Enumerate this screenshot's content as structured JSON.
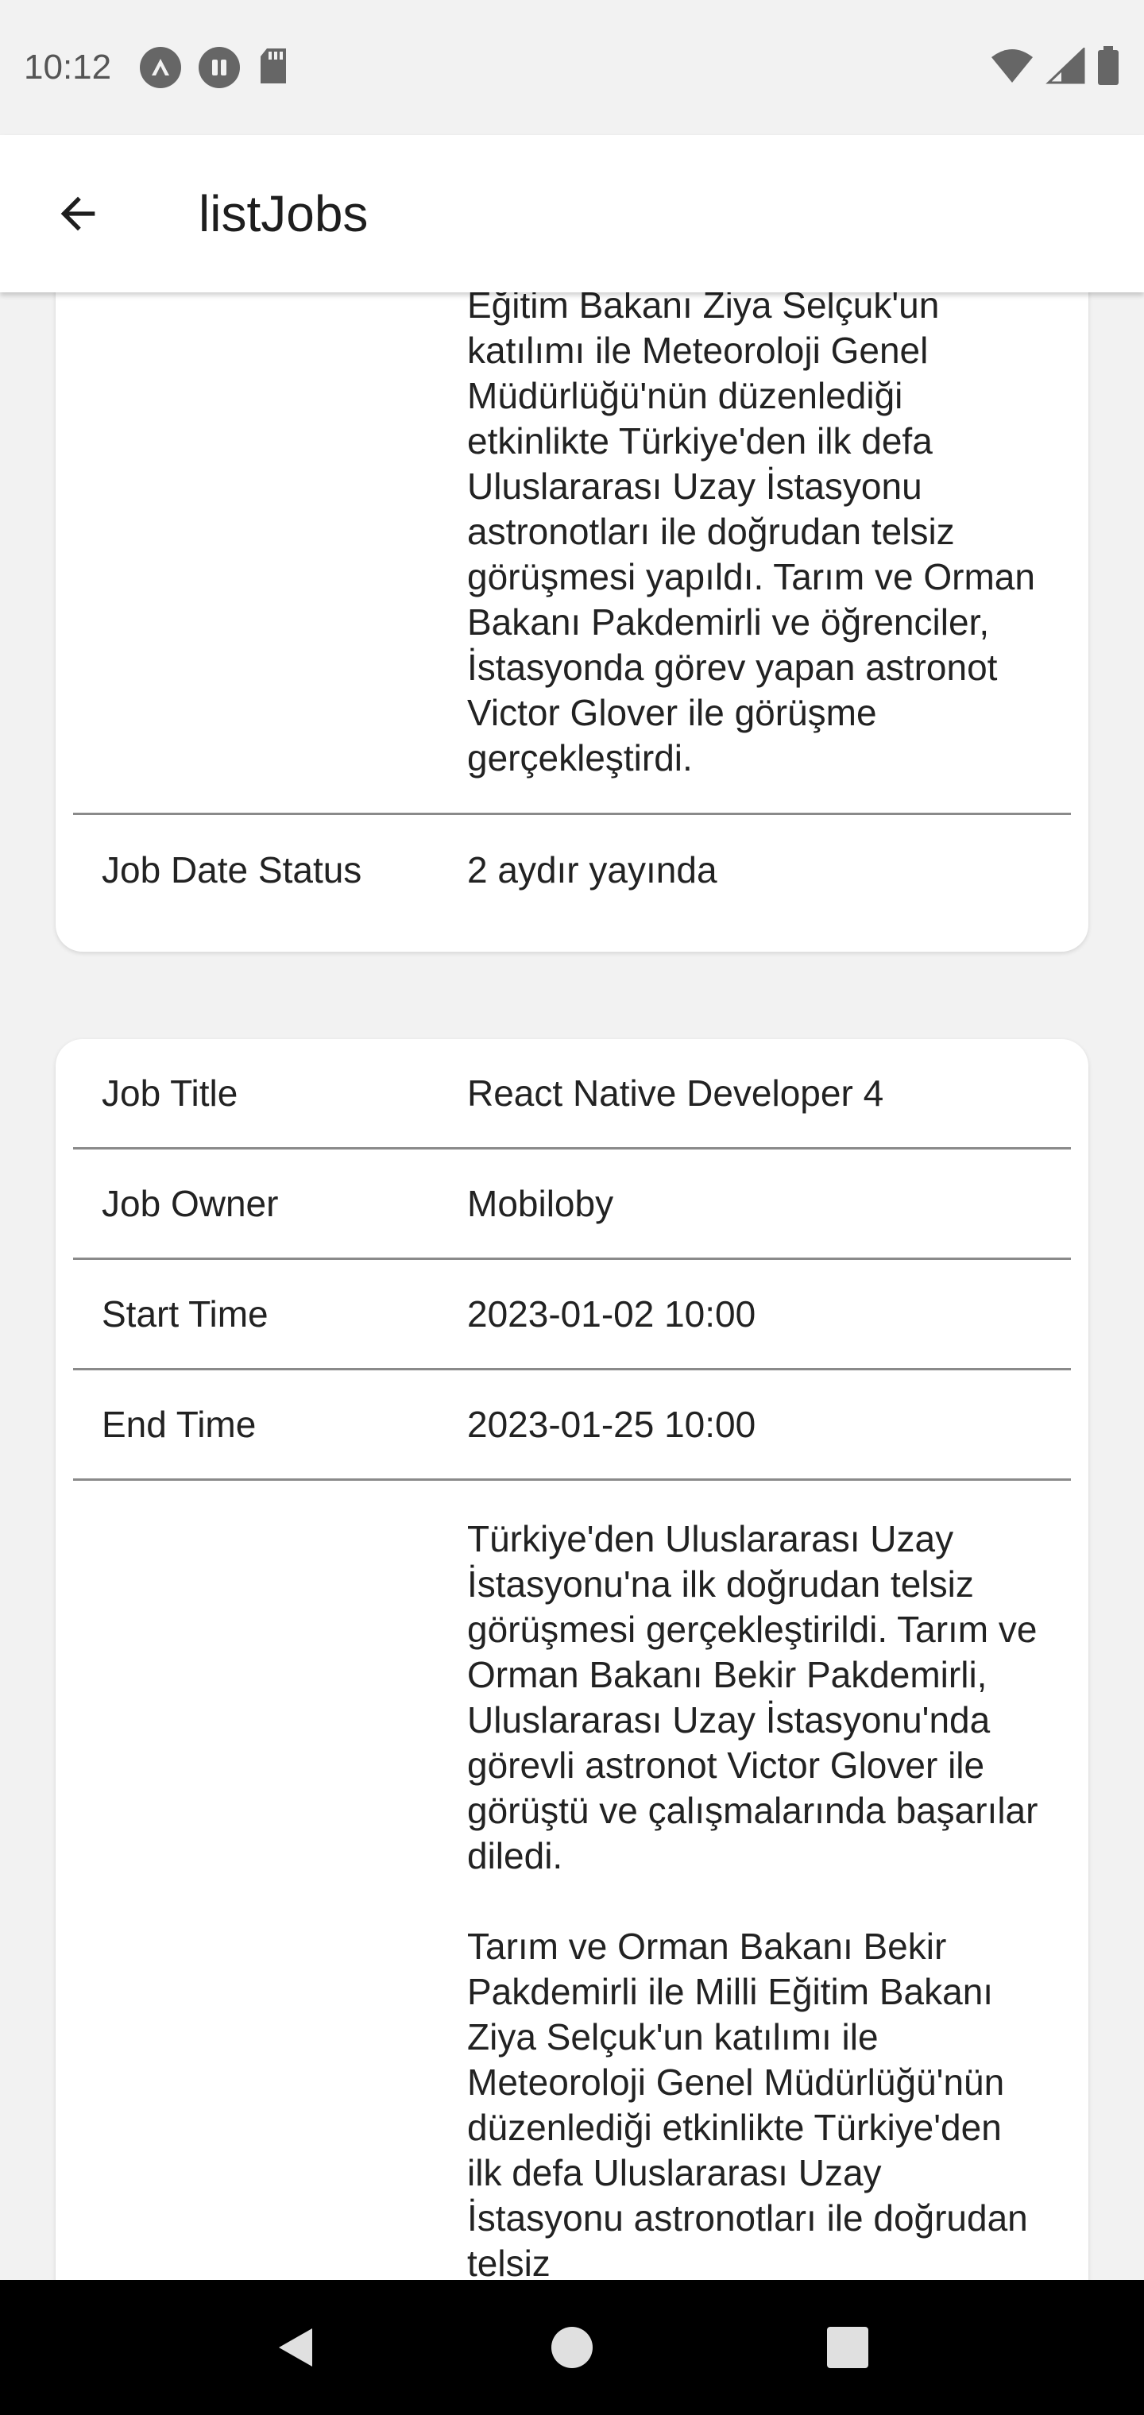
{
  "status_bar": {
    "time": "10:12",
    "left_icons": [
      "expo-icon",
      "pause-circle-icon",
      "sd-card-icon"
    ],
    "right_icons": [
      "wifi-icon",
      "cell-signal-icon",
      "battery-icon"
    ]
  },
  "app_bar": {
    "title": "listJobs",
    "back_icon": "arrow-left-icon"
  },
  "cards": [
    {
      "description": "Eğitim Bakanı Ziya Selçuk'un katılımı ile Meteoroloji Genel Müdürlüğü'nün düzenlediği etkinlikte Türkiye'den ilk defa Uluslararası Uzay İstasyonu astronotları ile doğrudan telsiz görüşmesi yapıldı. Tarım ve Orman Bakanı Pakdemirli ve öğrenciler, İstasyonda görev yapan astronot Victor Glover ile görüşme gerçekleştirdi.",
      "date_status_label": "Job Date Status",
      "date_status_value": "2 aydır yayında"
    },
    {
      "rows": [
        {
          "label": "Job Title",
          "value": "React Native Developer 4"
        },
        {
          "label": "Job Owner",
          "value": "Mobiloby"
        },
        {
          "label": "Start Time",
          "value": "2023-01-02 10:00"
        },
        {
          "label": "End Time",
          "value": "2023-01-25 10:00"
        }
      ],
      "description": "Türkiye'den Uluslararası Uzay İstasyonu'na ilk doğrudan telsiz görüşmesi gerçekleştirildi. Tarım ve Orman Bakanı Bekir Pakdemirli, Uluslararası Uzay İstasyonu'nda görevli astronot Victor Glover ile görüştü ve çalışmalarında başarılar diledi.\n\nTarım ve Orman Bakanı Bekir Pakdemirli ile Milli Eğitim Bakanı Ziya Selçuk'un katılımı ile Meteoroloji Genel Müdürlüğü'nün düzenlediği etkinlikte Türkiye'den ilk defa Uluslararası Uzay İstasyonu astronotları ile doğrudan telsiz"
    }
  ],
  "nav_bar": {
    "icons": [
      "back-triangle-icon",
      "home-circle-icon",
      "recents-square-icon"
    ]
  }
}
